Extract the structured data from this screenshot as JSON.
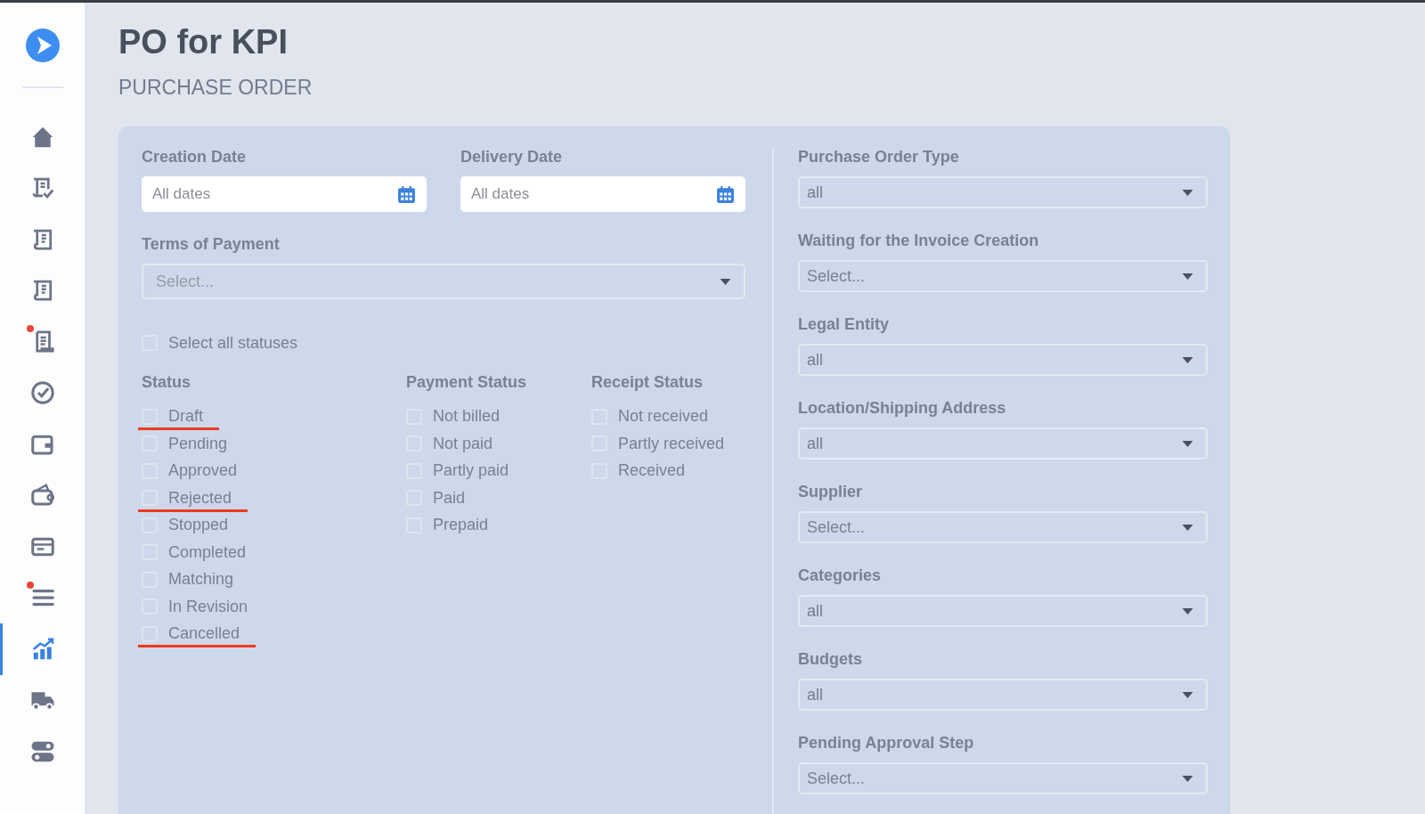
{
  "page": {
    "title": "PO for KPI",
    "subtitle": "PURCHASE ORDER"
  },
  "sidebar": {
    "items": [
      {
        "selected": false,
        "badge": false
      },
      {
        "selected": false,
        "badge": false
      },
      {
        "selected": false,
        "badge": false
      },
      {
        "selected": false,
        "badge": false
      },
      {
        "selected": false,
        "badge": true
      },
      {
        "selected": false,
        "badge": false
      },
      {
        "selected": false,
        "badge": false
      },
      {
        "selected": false,
        "badge": false
      },
      {
        "selected": false,
        "badge": false
      },
      {
        "selected": false,
        "badge": true
      },
      {
        "selected": true,
        "badge": false
      },
      {
        "selected": false,
        "badge": false
      },
      {
        "selected": false,
        "badge": false
      }
    ]
  },
  "date_filters": [
    {
      "label": "Creation Date",
      "placeholder": "All dates"
    },
    {
      "label": "Delivery Date",
      "placeholder": "All dates"
    }
  ],
  "terms_of_payment": {
    "label": "Terms of Payment",
    "placeholder": "Select..."
  },
  "select_all": {
    "label": "Select all statuses",
    "checked": false
  },
  "status_groups": [
    {
      "title": "Status",
      "options": [
        {
          "label": "Draft",
          "checked": false,
          "highlighted": true
        },
        {
          "label": "Pending",
          "checked": false,
          "highlighted": false
        },
        {
          "label": "Approved",
          "checked": false,
          "highlighted": false
        },
        {
          "label": "Rejected",
          "checked": false,
          "highlighted": true
        },
        {
          "label": "Stopped",
          "checked": false,
          "highlighted": false
        },
        {
          "label": "Completed",
          "checked": false,
          "highlighted": false
        },
        {
          "label": "Matching",
          "checked": false,
          "highlighted": false
        },
        {
          "label": "In Revision",
          "checked": false,
          "highlighted": false
        },
        {
          "label": "Cancelled",
          "checked": false,
          "highlighted": true
        }
      ]
    },
    {
      "title": "Payment Status",
      "options": [
        {
          "label": "Not billed",
          "checked": false,
          "highlighted": false
        },
        {
          "label": "Not paid",
          "checked": false,
          "highlighted": false
        },
        {
          "label": "Partly paid",
          "checked": false,
          "highlighted": false
        },
        {
          "label": "Paid",
          "checked": false,
          "highlighted": false
        },
        {
          "label": "Prepaid",
          "checked": false,
          "highlighted": false
        }
      ]
    },
    {
      "title": "Receipt Status",
      "options": [
        {
          "label": "Not received",
          "checked": false,
          "highlighted": false
        },
        {
          "label": "Partly received",
          "checked": false,
          "highlighted": false
        },
        {
          "label": "Received",
          "checked": false,
          "highlighted": false
        }
      ]
    }
  ],
  "right_filters": [
    {
      "label": "Purchase Order Type",
      "value": "all"
    },
    {
      "label": "Waiting for the Invoice Creation",
      "placeholder": "Select..."
    },
    {
      "label": "Legal Entity",
      "value": "all"
    },
    {
      "label": "Location/Shipping Address",
      "value": "all"
    },
    {
      "label": "Supplier",
      "placeholder": "Select..."
    },
    {
      "label": "Categories",
      "value": "all"
    },
    {
      "label": "Budgets",
      "value": "all"
    },
    {
      "label": "Pending Approval Step",
      "placeholder": "Select..."
    }
  ]
}
